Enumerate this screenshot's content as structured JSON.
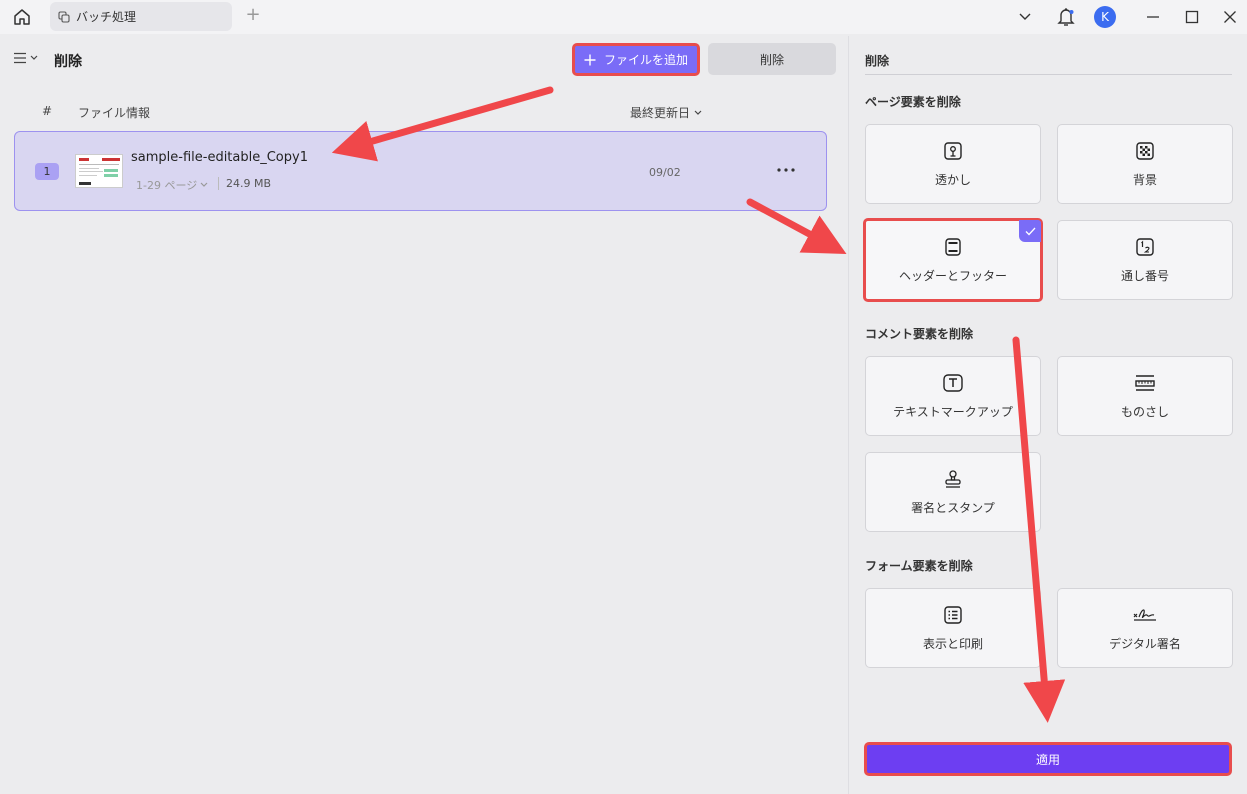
{
  "titlebar": {
    "tab_label": "バッチ処理",
    "avatar_letter": "K"
  },
  "left": {
    "title": "削除",
    "add_file_label": "ファイルを追加",
    "delete_label": "削除",
    "columns": {
      "index": "#",
      "info": "ファイル情報",
      "modified": "最終更新日"
    },
    "files": [
      {
        "index": "1",
        "name": "sample-file-editable_Copy1",
        "pages": "1-29 ページ",
        "size": "24.9 MB",
        "date": "09/02"
      }
    ]
  },
  "right": {
    "title": "削除",
    "sections": {
      "page": "ページ要素を削除",
      "comment": "コメント要素を削除",
      "form": "フォーム要素を削除"
    },
    "options": {
      "watermark": "透かし",
      "background": "背景",
      "header_footer": "ヘッダーとフッター",
      "bates": "通し番号",
      "text_markup": "テキストマークアップ",
      "ruler": "ものさし",
      "signature_stamp": "署名とスタンプ",
      "display_print": "表示と印刷",
      "digital_signature": "デジタル署名"
    },
    "selected_option": "header_footer",
    "apply_label": "適用"
  },
  "colors": {
    "accent": "#7a6cf7",
    "apply": "#6d3ef2",
    "highlight": "#e84d4d",
    "selected_row": "#d9d6f1"
  }
}
